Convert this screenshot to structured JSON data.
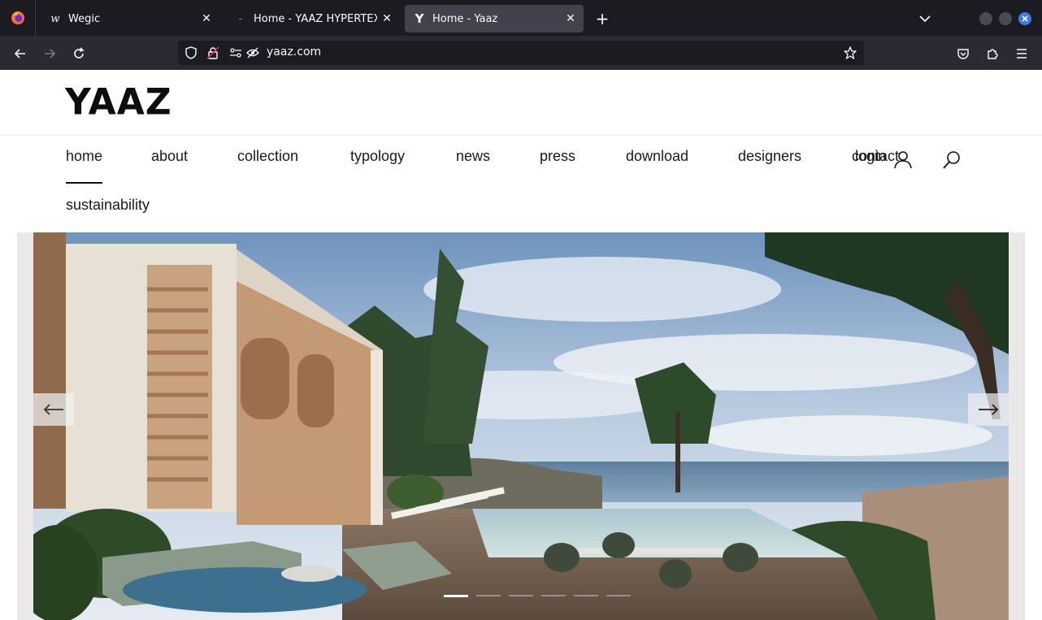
{
  "browser": {
    "tabs": [
      {
        "title": "Wegic",
        "icon": "wegic-favicon-icon",
        "active": false
      },
      {
        "title": "Home - YAAZ HYPERTEXT",
        "icon": "yaaz-hypertext-favicon-icon",
        "active": false
      },
      {
        "title": "Home - Yaaz",
        "icon": "yaaz-favicon-icon",
        "active": true
      }
    ],
    "url": "yaaz.com",
    "accent_color": "#3a7bf0"
  },
  "site": {
    "logo": "YAAZ",
    "nav": [
      {
        "label": "home",
        "active": true
      },
      {
        "label": "about"
      },
      {
        "label": "collection"
      },
      {
        "label": "typology"
      },
      {
        "label": "news"
      },
      {
        "label": "press"
      },
      {
        "label": "download"
      },
      {
        "label": "designers"
      },
      {
        "label": "contact"
      },
      {
        "label": "sustainability"
      }
    ],
    "login_label": "login",
    "user_icon": "user-icon",
    "search_icon": "search-icon"
  },
  "hero": {
    "slides_total": 6,
    "active_slide": 1,
    "prev_icon": "arrow-left-icon",
    "next_icon": "arrow-right-icon"
  }
}
